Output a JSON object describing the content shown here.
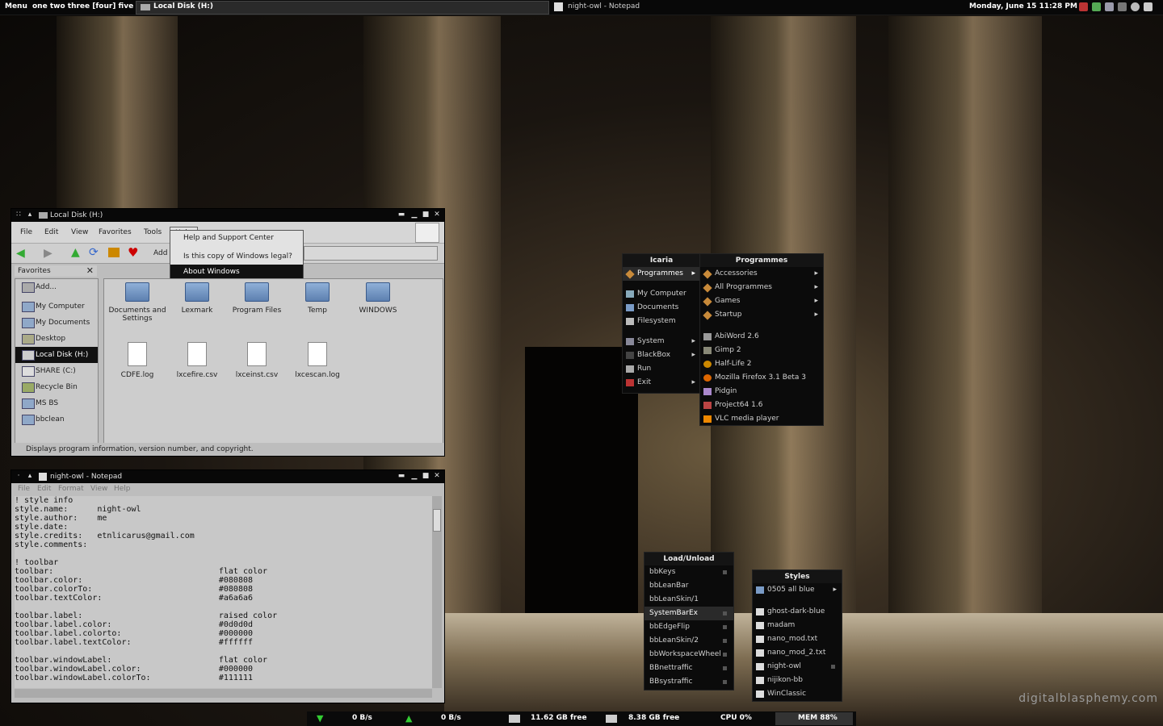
{
  "topbar": {
    "menu_label": "Menu",
    "workspaces": "one  two  three [four] five",
    "task1": "Local Disk (H:)",
    "task2": "night-owl - Notepad",
    "clock": "Monday, June 15  11:28 PM"
  },
  "explorer": {
    "title": "Local Disk (H:)",
    "menu": [
      "File",
      "Edit",
      "View",
      "Favorites",
      "Tools",
      "Help"
    ],
    "toolbar_add": "Add",
    "help_menu": [
      "Help and Support Center",
      "Is this copy of Windows legal?",
      "About Windows"
    ],
    "sidebar_header": "Favorites",
    "sidebar_add": "Add...",
    "sidebar_items": [
      "My Computer",
      "My Documents",
      "Desktop",
      "Local Disk (H:)",
      "SHARE (C:)",
      "Recycle Bin",
      "MS BS",
      "bbclean"
    ],
    "folders": [
      "Documents and Settings",
      "Lexmark",
      "Program Files",
      "Temp",
      "WINDOWS"
    ],
    "documents": [
      "CDFE.log",
      "lxcefire.csv",
      "lxceinst.csv",
      "lxcescan.log"
    ],
    "status": "Displays program information, version number, and copyright."
  },
  "notepad": {
    "title": "night-owl - Notepad",
    "menu": [
      "File",
      "Edit",
      "Format",
      "View",
      "Help"
    ],
    "text": "! style info\nstyle.name:      night-owl\nstyle.author:    me\nstyle.date:\nstyle.credits:   etnlicarus@gmail.com\nstyle.comments:\n\n! toolbar\ntoolbar:                                  flat color\ntoolbar.color:                            #080808\ntoolbar.colorTo:                          #080808\ntoolbar.textColor:                        #a6a6a6\n\ntoolbar.label:                            raised color\ntoolbar.label.color:                      #0d0d0d\ntoolbar.label.colorto:                    #000000\ntoolbar.label.textColor:                  #ffffff\n\ntoolbar.windowLabel:                      flat color\ntoolbar.windowLabel.color:                #000000\ntoolbar.windowLabel.colorTo:              #111111"
  },
  "icaria_menu": {
    "header": "Icaria",
    "items": [
      "Programmes",
      "My Computer",
      "Documents",
      "Filesystem",
      "System",
      "BlackBox",
      "Run",
      "Exit"
    ]
  },
  "programmes_menu": {
    "header": "Programmes",
    "folders": [
      "Accessories",
      "All Programmes",
      "Games",
      "Startup"
    ],
    "apps": [
      "AbiWord 2.6",
      "Gimp 2",
      "Half-Life 2",
      "Mozilla Firefox 3.1 Beta 3",
      "Pidgin",
      "Project64 1.6",
      "VLC media player"
    ]
  },
  "load_menu": {
    "header": "Load/Unload",
    "items": [
      "bbKeys",
      "bbLeanBar",
      "bbLeanSkin/1",
      "SystemBarEx",
      "bbEdgeFlip",
      "bbLeanSkin/2",
      "bbWorkspaceWheel",
      "BBnettraffic",
      "BBsystraffic"
    ]
  },
  "styles_menu": {
    "header": "Styles",
    "folder": "0505 all blue",
    "items": [
      "ghost-dark-blue",
      "madam",
      "nano_mod.txt",
      "nano_mod_2.txt",
      "night-owl",
      "nijikon-bb",
      "WinClassic"
    ]
  },
  "bottombar": {
    "down": "0 B/s",
    "up": "0 B/s",
    "disk1": "11.62 GB  free",
    "disk2": "8.38 GB  free",
    "cpu": "CPU 0%",
    "mem": "MEM 88%"
  },
  "watermark": "digitalblasphemy.com"
}
